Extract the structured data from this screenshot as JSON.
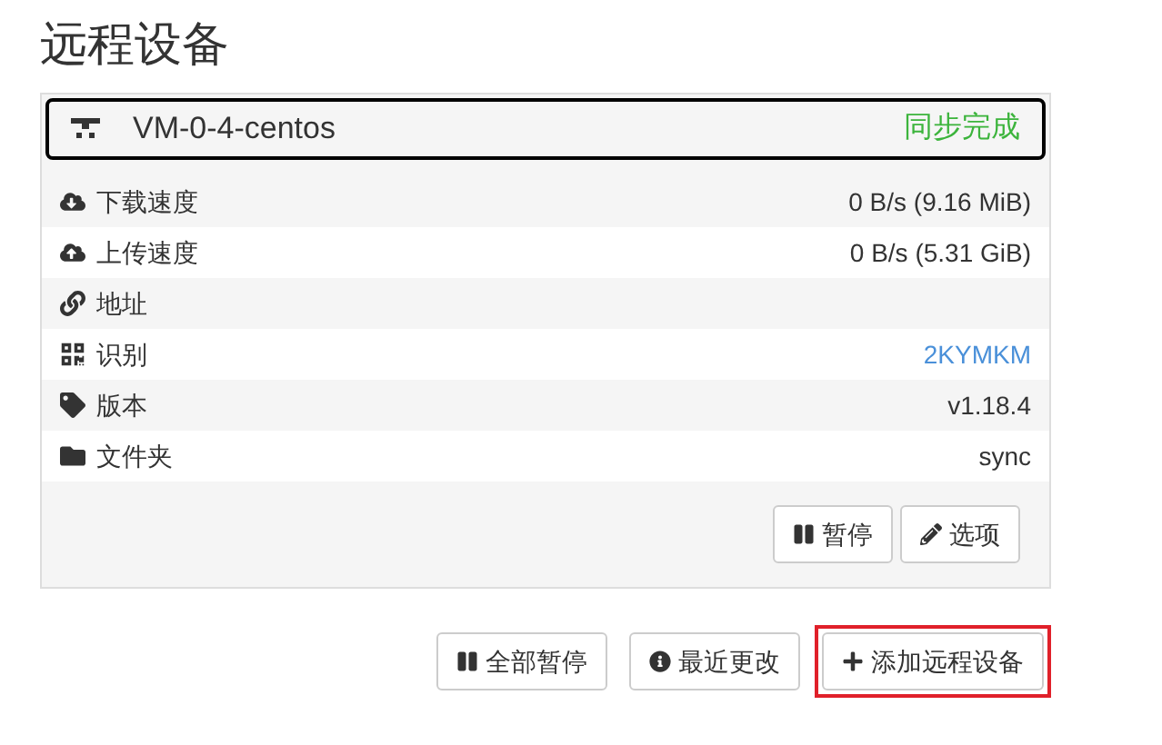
{
  "title": "远程设备",
  "device": {
    "name": "VM-0-4-centos",
    "status": "同步完成",
    "rows": [
      {
        "kind": "download",
        "label": "下载速度",
        "value": "0 B/s (9.16 MiB)"
      },
      {
        "kind": "upload",
        "label": "上传速度",
        "value": "0 B/s (5.31 GiB)"
      },
      {
        "kind": "address",
        "label": "地址"
      },
      {
        "kind": "id",
        "label": "识别",
        "value": "2KYMKM"
      },
      {
        "kind": "version",
        "label": "版本",
        "value": "v1.18.4"
      },
      {
        "kind": "folder",
        "label": "文件夹",
        "value": "sync"
      }
    ],
    "buttons": [
      {
        "kind": "pause",
        "label": "暂停"
      },
      {
        "kind": "edit",
        "label": "选项"
      }
    ]
  },
  "actions": [
    {
      "kind": "pause",
      "label": "全部暂停",
      "highlighted": false
    },
    {
      "kind": "info",
      "label": "最近更改",
      "highlighted": false
    },
    {
      "kind": "add",
      "label": "添加远程设备",
      "highlighted": true
    }
  ]
}
